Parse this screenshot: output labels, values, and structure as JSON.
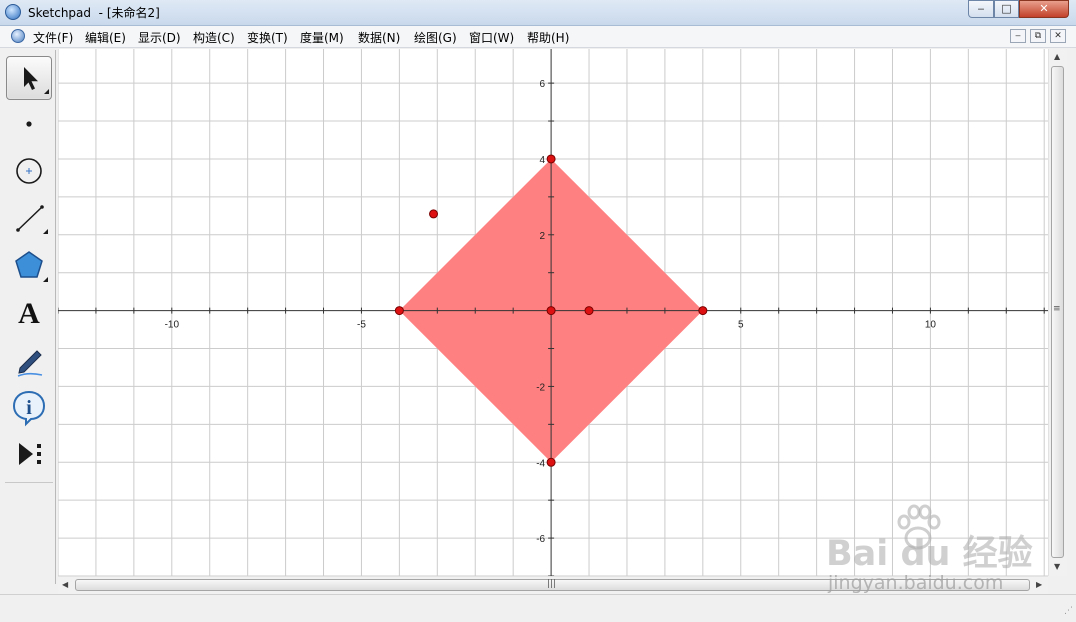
{
  "window": {
    "app_name": "Sketchpad",
    "title_separator": "  - ",
    "document_title": "[未命名2]",
    "minimize_label": "‒",
    "maximize_label": "□",
    "close_label": "✕"
  },
  "menu": {
    "items": [
      "文件(F)",
      "编辑(E)",
      "显示(D)",
      "构造(C)",
      "变换(T)",
      "度量(M)",
      "数据(N)",
      "绘图(G)",
      "窗口(W)",
      "帮助(H)"
    ],
    "mdi_minimize": "‒",
    "mdi_restore": "⧉",
    "mdi_close": "✕"
  },
  "toolbox": {
    "tools": [
      {
        "name": "arrow-select-tool",
        "icon": "arrow-icon",
        "active": true
      },
      {
        "name": "point-tool",
        "icon": "point-icon",
        "active": false
      },
      {
        "name": "compass-tool",
        "icon": "circle-icon",
        "active": false
      },
      {
        "name": "straightedge-tool",
        "icon": "segment-icon",
        "active": false
      },
      {
        "name": "polygon-tool",
        "icon": "pentagon-icon",
        "active": false
      },
      {
        "name": "text-tool",
        "icon": "text-a-icon",
        "active": false
      },
      {
        "name": "marker-tool",
        "icon": "pen-icon",
        "active": false
      },
      {
        "name": "information-tool",
        "icon": "info-icon",
        "active": false
      },
      {
        "name": "custom-tool",
        "icon": "play-custom-icon",
        "active": false
      }
    ],
    "text_tool_glyph": "A",
    "info_tool_glyph": "i"
  },
  "colors": {
    "polygon_fill": "#ff8080",
    "point_fill": "#dd1111",
    "point_stroke": "#7a0000",
    "grid": "#cccccc",
    "axis": "#333333"
  },
  "chart_data": {
    "type": "scatter",
    "title": "",
    "xlabel": "",
    "ylabel": "",
    "xlim": [
      -13,
      13.1
    ],
    "ylim": [
      -7,
      6.9
    ],
    "grid": true,
    "x_ticks": [
      {
        "value": -10,
        "label": "-10"
      },
      {
        "value": -5,
        "label": "-5"
      },
      {
        "value": 5,
        "label": "5"
      },
      {
        "value": 10,
        "label": "10"
      }
    ],
    "y_ticks": [
      {
        "value": 6,
        "label": "6"
      },
      {
        "value": 4,
        "label": "4"
      },
      {
        "value": 2,
        "label": "2"
      },
      {
        "value": -2,
        "label": "-2"
      },
      {
        "value": -4,
        "label": "-4"
      },
      {
        "value": -6,
        "label": "-6"
      }
    ],
    "polygon": [
      [
        0,
        4
      ],
      [
        4,
        0
      ],
      [
        0,
        -4
      ],
      [
        -4,
        0
      ]
    ],
    "points": [
      {
        "x": 0,
        "y": 4
      },
      {
        "x": -4,
        "y": 0
      },
      {
        "x": 0,
        "y": 0
      },
      {
        "x": 1,
        "y": 0
      },
      {
        "x": 4,
        "y": 0
      },
      {
        "x": 0,
        "y": -4
      },
      {
        "x": -3.1,
        "y": 2.55
      }
    ]
  },
  "scrollbars": {
    "up_arrow": "▲",
    "down_arrow": "▼",
    "left_arrow": "◀",
    "right_arrow": "▶",
    "grip": "|||",
    "vgrip": "≡",
    "resize": "⋰"
  },
  "watermark": {
    "brand": "Bai   du 经验",
    "url": "jingyan.baidu.com"
  }
}
